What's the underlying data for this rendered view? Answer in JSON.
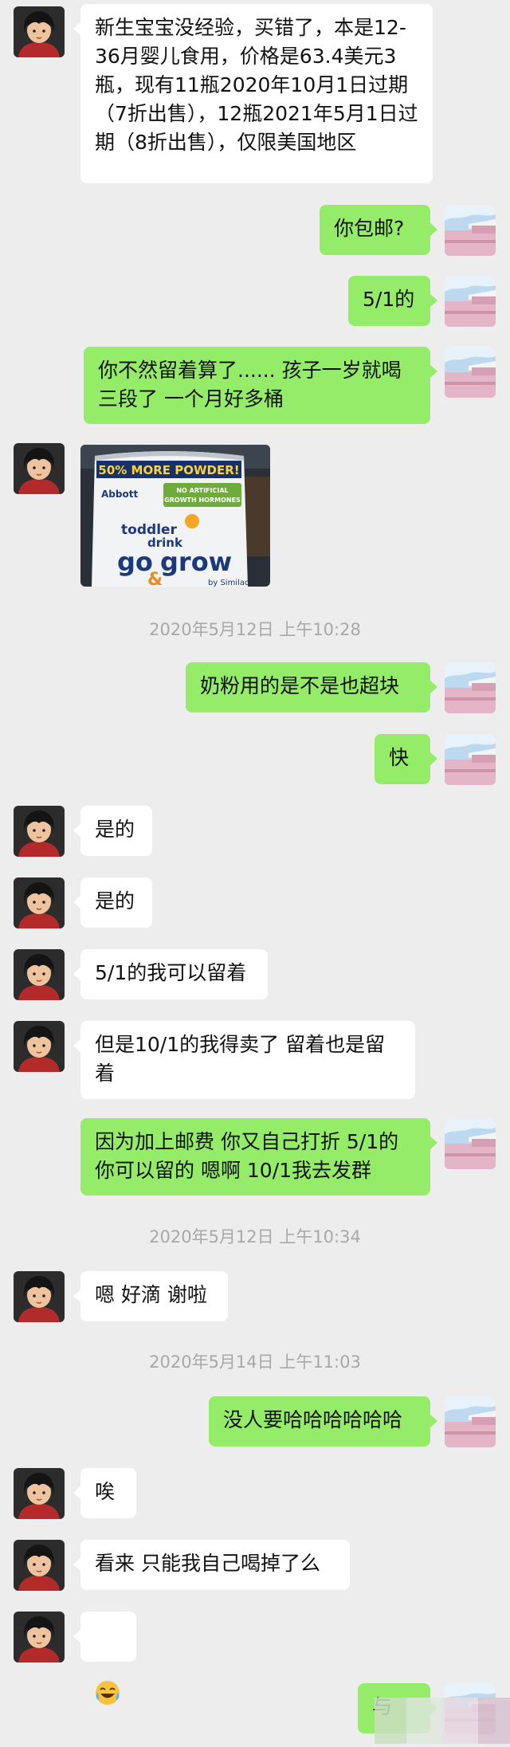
{
  "chat": {
    "m1": "新生宝宝没经验，买错了，本是12-36月婴儿食用，价格是63.4美元3瓶，现有11瓶2020年10月1日过期（7折出售），12瓶2021年5月1日过期（8折出售），仅限美国地区",
    "m2": "你包邮?",
    "m3": "5/1的",
    "m4": "你不然留着算了...... 孩子一岁就喝三段了 一个月好多桶",
    "photo": {
      "banner": "50% MORE POWDER!",
      "brand": "Abbott",
      "badge_line1": "NO ARTIFICIAL",
      "badge_line2": "GROWTH HORMONES",
      "toddler": "toddler",
      "drink": "drink",
      "go": "go",
      "grow": "grow",
      "amp": "&",
      "similac": "by Similac"
    },
    "t1": "2020年5月12日 上午10:28",
    "m5": "奶粉用的是不是也超块",
    "m6": "快",
    "m7": "是的",
    "m8": "是的",
    "m9": "5/1的我可以留着",
    "m10": "但是10/1的我得卖了 留着也是留着",
    "m11": "因为加上邮费 你又自己打折 5/1的你可以留的 嗯啊 10/1我去发群",
    "t2": "2020年5月12日 上午10:34",
    "m12": "嗯 好滴 谢啦",
    "t3": "2020年5月14日 上午11:03",
    "m13": "没人要哈哈哈哈哈哈",
    "m14": "唉",
    "m15": "看来 只能我自己喝掉了么",
    "m16_icon": "laughing-crying-emoji",
    "m17": "与"
  },
  "colors": {
    "background": "#ededed",
    "incoming_bubble": "#ffffff",
    "outgoing_bubble": "#95ec69",
    "timestamp": "#a8a8a8"
  }
}
